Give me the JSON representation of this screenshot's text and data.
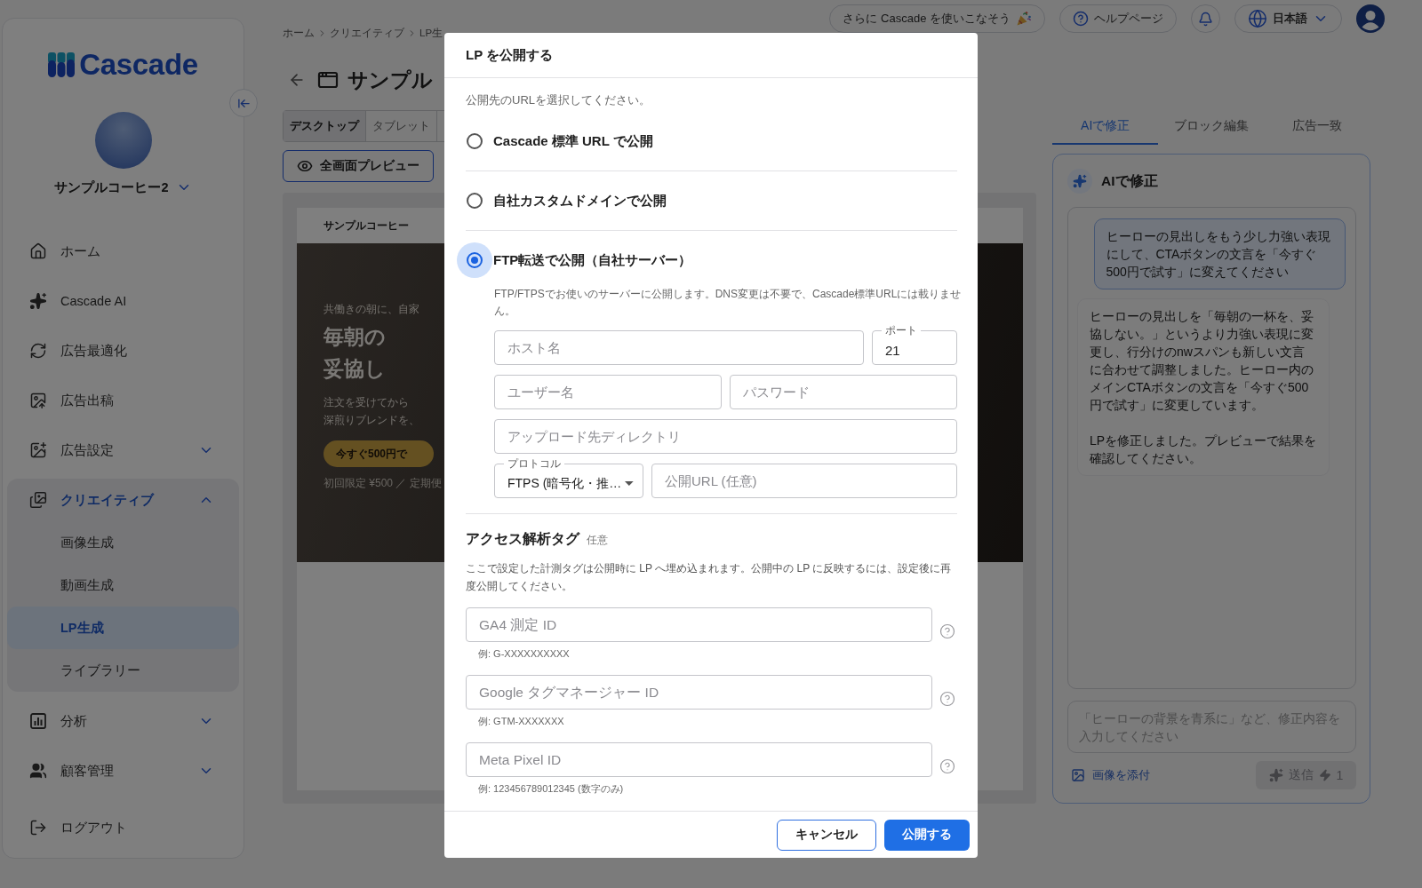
{
  "sidebar": {
    "logo": "Cascade",
    "account": "サンプルコーヒー2",
    "nav": [
      {
        "label": "ホーム",
        "selected": false
      },
      {
        "label": "Cascade AI",
        "selected": false
      },
      {
        "label": "広告最適化",
        "selected": false
      },
      {
        "label": "広告出稿",
        "selected": false
      },
      {
        "label": "広告設定",
        "selected": false,
        "expanded": false
      },
      {
        "label": "クリエイティブ",
        "selected": true,
        "expanded": true,
        "children": [
          {
            "label": "画像生成",
            "selected": false
          },
          {
            "label": "動画生成",
            "selected": false
          },
          {
            "label": "LP生成",
            "selected": true
          },
          {
            "label": "ライブラリー",
            "selected": false
          }
        ]
      },
      {
        "label": "分析",
        "selected": false,
        "expanded": false
      },
      {
        "label": "顧客管理",
        "selected": false,
        "expanded": false
      },
      {
        "label": "ログアウト",
        "selected": false
      }
    ]
  },
  "topbar": {
    "breadcrumbs": [
      "ホーム",
      "クリエイティブ",
      "LP生"
    ],
    "promo": "さらに Cascade を使いこなそう",
    "help": "ヘルプページ",
    "language": "日本語"
  },
  "editor": {
    "title": "サンプル",
    "device_tabs": [
      {
        "label": "デスクトップ",
        "selected": true
      },
      {
        "label": "タブレット",
        "selected": false
      }
    ],
    "preview_button": "全画面プレビュー",
    "preview": {
      "brand": "サンプルコーヒー",
      "eyebrow": "共働きの朝に、自家",
      "headline": [
        "毎朝の",
        "妥協し"
      ],
      "body": [
        "注文を受けてから",
        "深煎りブレンドを、"
      ],
      "cta": "今すぐ500円で",
      "note": "初回限定 ¥500 ／ 定期便"
    }
  },
  "assistant": {
    "tabs": [
      {
        "label": "AIで修正",
        "selected": true
      },
      {
        "label": "ブロック編集",
        "selected": false
      },
      {
        "label": "広告一致",
        "selected": false
      }
    ],
    "title": "AIで修正",
    "messages": [
      {
        "kind": "user",
        "paragraphs": [
          "ヒーローの見出しをもう少し力強い表現にして、CTAボタンの文言を「今すぐ500円で試す」に変えてください"
        ]
      },
      {
        "kind": "ai",
        "paragraphs": [
          "ヒーローの見出しを「毎朝の一杯を、妥協しない。」というより力強い表現に変更し、行分けのnwスパンも新しい文言に合わせて調整しました。ヒーロー内のメインCTAボタンの文言を「今すぐ500円で試す」に変更しています。",
          "LPを修正しました。プレビューで結果を確認してください。"
        ]
      }
    ],
    "input": {
      "placeholder": "「ヒーローの背景を青系に」など、修正内容を入力してください"
    },
    "attach": "画像を添付",
    "send": {
      "label": "送信",
      "credits": "1",
      "disabled": true
    }
  },
  "modal": {
    "title": "LP を公開する",
    "prompt": "公開先のURLを選択してください。",
    "options": [
      {
        "label": "Cascade 標準 URL で公開",
        "selected": false
      },
      {
        "label": "自社カスタムドメインで公開",
        "selected": false
      },
      {
        "label": "FTP転送で公開（自社サーバー）",
        "selected": true,
        "description": "FTP/FTPSでお使いのサーバーに公開します。DNS変更は不要で、Cascade標準URLには載りません。",
        "fields": [
          [
            {
              "kind": "text",
              "placeholder": "ホスト名"
            },
            {
              "kind": "outlined",
              "label": "ポート",
              "value": "21"
            }
          ],
          [
            {
              "kind": "text",
              "placeholder": "ユーザー名"
            },
            {
              "kind": "text",
              "placeholder": "パスワード"
            }
          ],
          [
            {
              "kind": "text",
              "placeholder": "アップロード先ディレクトリ"
            }
          ],
          [
            {
              "kind": "select",
              "label": "プロトコル",
              "value": "FTPS (暗号化・推…"
            },
            {
              "kind": "text",
              "placeholder": "公開URL (任意)"
            }
          ]
        ]
      }
    ],
    "analytics": {
      "title": "アクセス解析タグ",
      "badge": "任意",
      "note": "ここで設定した計測タグは公開時に LP へ埋め込まれます。公開中の LP に反映するには、設定後に再度公開してください。",
      "fields": [
        {
          "placeholder": "GA4 測定 ID",
          "hint": "例: G-XXXXXXXXXX"
        },
        {
          "placeholder": "Google タグマネージャー ID",
          "hint": "例: GTM-XXXXXXX"
        },
        {
          "placeholder": "Meta Pixel ID",
          "hint": "例: 123456789012345 (数字のみ)"
        }
      ]
    },
    "buttons": [
      {
        "label": "キャンセル",
        "kind": "secondary"
      },
      {
        "label": "公開する",
        "kind": "primary"
      }
    ]
  }
}
